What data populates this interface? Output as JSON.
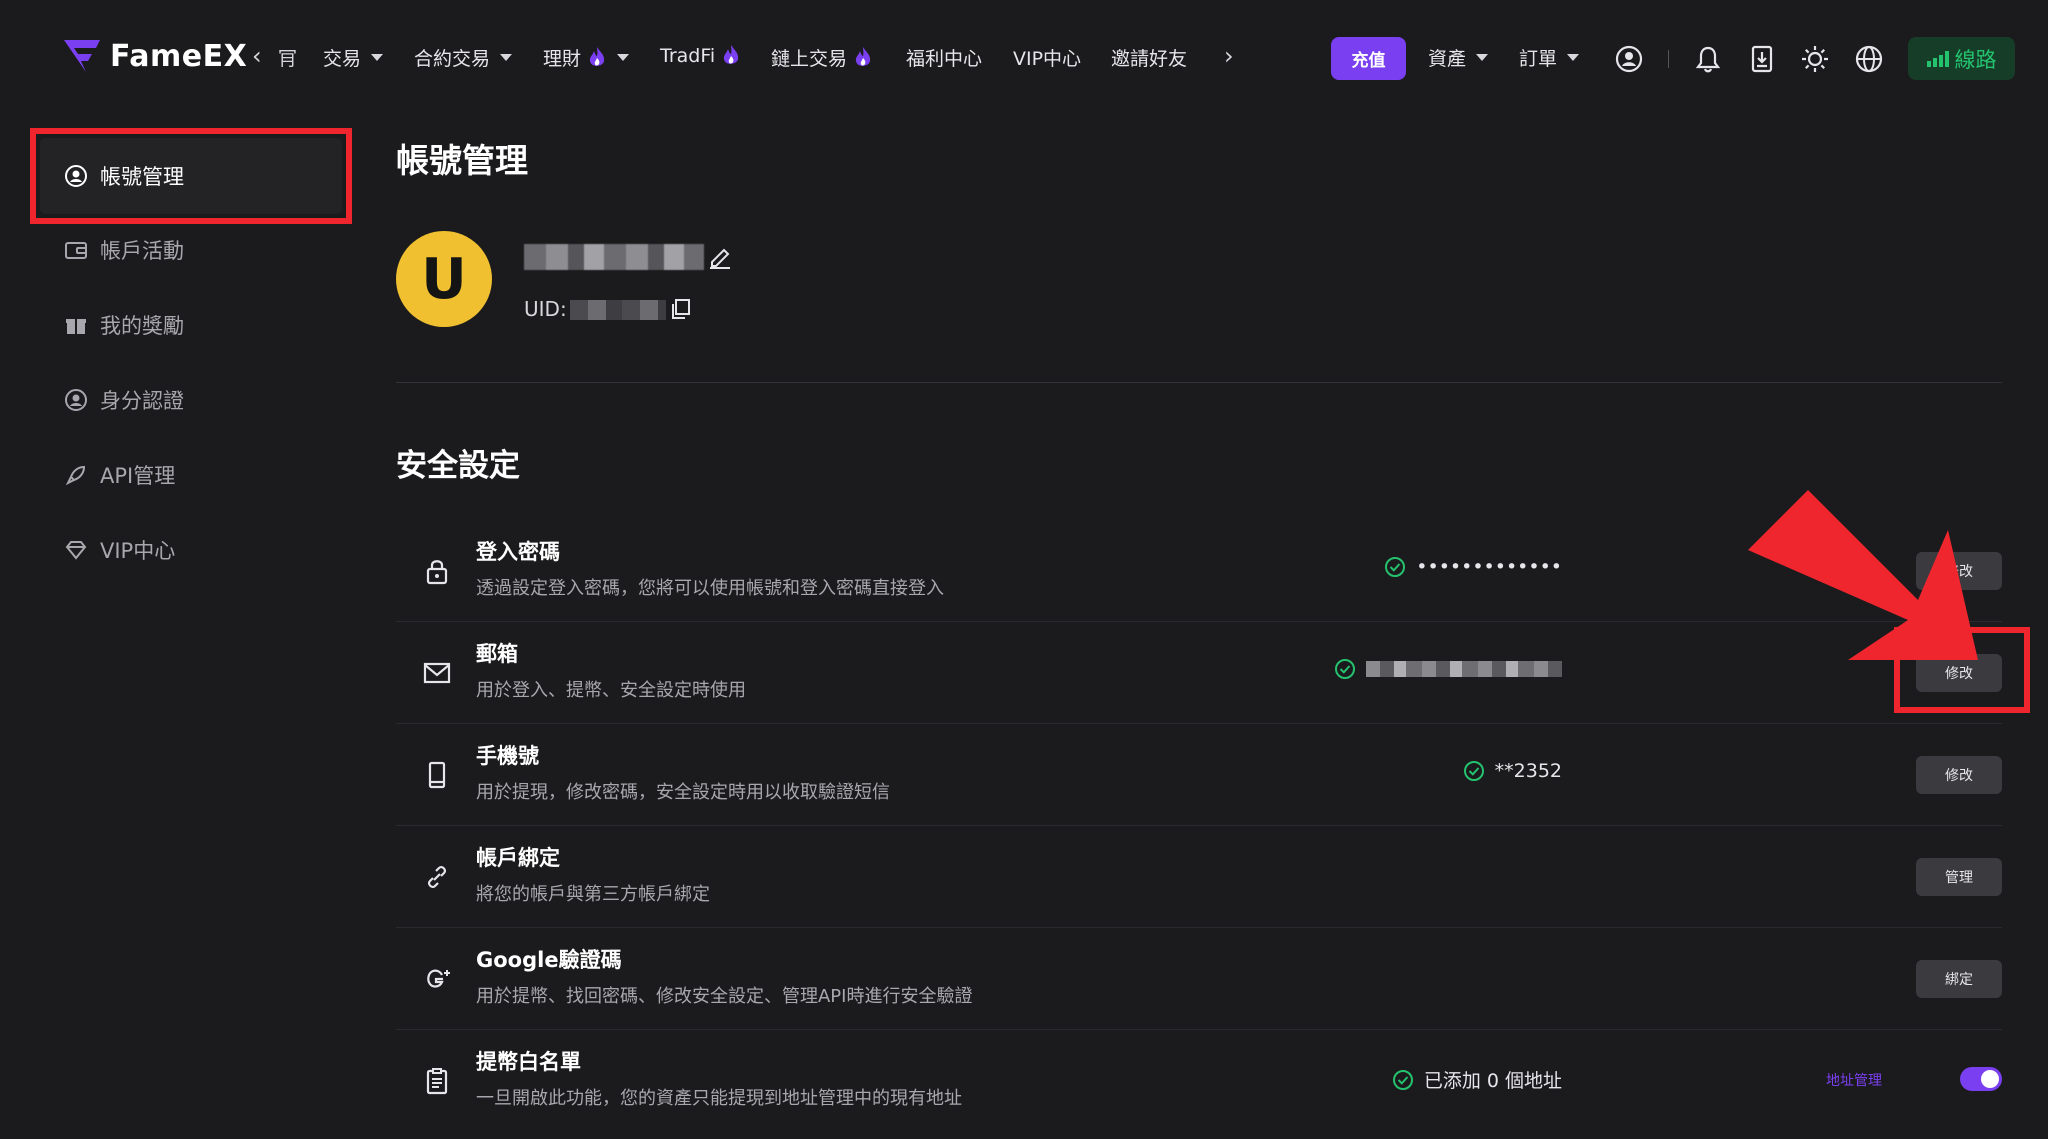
{
  "brand": {
    "name": "FameEX",
    "accent": "#7b3ff2",
    "success": "#24c26e",
    "highlight": "#f0262e"
  },
  "nav": {
    "cut_text": "肎",
    "items": [
      {
        "label": "交易",
        "dropdown": true,
        "flame": false
      },
      {
        "label": "合約交易",
        "dropdown": true,
        "flame": false
      },
      {
        "label": "理財",
        "dropdown": true,
        "flame": true
      },
      {
        "label": "TradFi",
        "dropdown": false,
        "flame": true
      },
      {
        "label": "鏈上交易",
        "dropdown": false,
        "flame": true
      },
      {
        "label": "福利中心",
        "dropdown": false,
        "flame": false
      },
      {
        "label": "VIP中心",
        "dropdown": false,
        "flame": false
      },
      {
        "label": "邀請好友",
        "dropdown": false,
        "flame": false
      }
    ],
    "deposit": "充值",
    "assets": "資產",
    "orders": "訂單",
    "line": "線路",
    "icons": [
      "user-circle-icon",
      "bell-icon",
      "download-icon",
      "sun-icon",
      "globe-icon"
    ]
  },
  "sidebar": {
    "items": [
      {
        "label": "帳號管理",
        "icon": "user-circle-icon",
        "active": true
      },
      {
        "label": "帳戶活動",
        "icon": "wallet-icon",
        "active": false
      },
      {
        "label": "我的獎勵",
        "icon": "gift-icon",
        "active": false
      },
      {
        "label": "身分認證",
        "icon": "id-icon",
        "active": false
      },
      {
        "label": "API管理",
        "icon": "rocket-icon",
        "active": false
      },
      {
        "label": "VIP中心",
        "icon": "diamond-icon",
        "active": false
      }
    ]
  },
  "profile": {
    "page_title": "帳號管理",
    "avatar_letter": "U",
    "uid_label": "UID:"
  },
  "security": {
    "title": "安全設定",
    "rows": [
      {
        "title": "登入密碼",
        "desc": "透過設定登入密碼，您將可以使用帳號和登入密碼直接登入",
        "status": "•••••••••••••",
        "verified": true,
        "action": "修改",
        "icon": "lock-icon"
      },
      {
        "title": "郵箱",
        "desc": "用於登入、提幣、安全設定時使用",
        "status": "",
        "verified": true,
        "action": "修改",
        "icon": "mail-icon"
      },
      {
        "title": "手機號",
        "desc": "用於提現，修改密碼，安全設定時用以收取驗證短信",
        "status": "**2352",
        "verified": true,
        "action": "修改",
        "icon": "phone-icon"
      },
      {
        "title": "帳戶綁定",
        "desc": "將您的帳戶與第三方帳戶綁定",
        "status": "",
        "verified": false,
        "action": "管理",
        "icon": "link-icon"
      },
      {
        "title": "Google驗證碼",
        "desc": "用於提幣、找回密碼、修改安全設定、管理API時進行安全驗證",
        "status": "",
        "verified": false,
        "action": "綁定",
        "icon": "google-plus-icon"
      },
      {
        "title": "提幣白名單",
        "desc": "一旦開啟此功能，您的資產只能提現到地址管理中的現有地址",
        "status": "已添加 0 個地址",
        "verified": true,
        "action": "",
        "link": "地址管理",
        "toggle": true,
        "icon": "clipboard-icon"
      }
    ]
  }
}
